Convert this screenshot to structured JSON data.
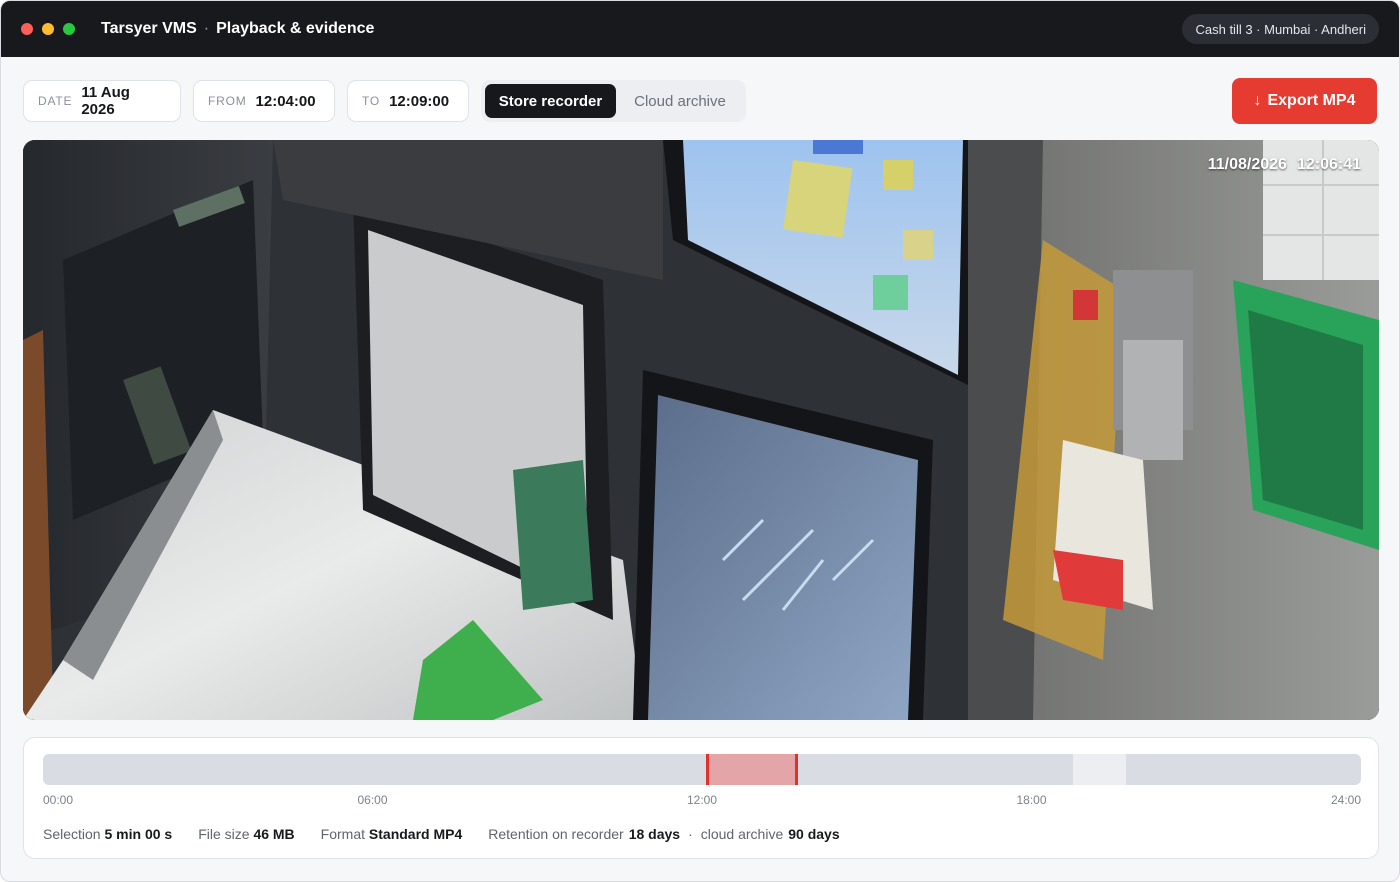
{
  "window": {
    "app_name": "Tarsyer VMS",
    "separator": "·",
    "page_title": "Playback & evidence",
    "location": "Cash till 3 · Mumbai · Andheri"
  },
  "toolbar": {
    "date": {
      "label": "DATE",
      "value": "11 Aug 2026"
    },
    "from": {
      "label": "FROM",
      "value": "12:04:00"
    },
    "to": {
      "label": "TO",
      "value": "12:09:00"
    },
    "source_options": [
      "Store recorder",
      "Cloud archive"
    ],
    "source_selected": "Store recorder",
    "export_icon": "down-arrow-icon",
    "export_glyph": "↓",
    "export_label": "Export MP4",
    "accent_color": "#e53b30"
  },
  "video": {
    "timestamp_date": "11/08/2026",
    "timestamp_time": "12:06:41"
  },
  "timeline": {
    "range_hours": [
      0,
      24
    ],
    "selection_hours": [
      12.067,
      13.75
    ],
    "recording_gap_hours": [
      18.75,
      19.72
    ],
    "ticks": [
      "00:00",
      "06:00",
      "12:00",
      "18:00",
      "24:00"
    ],
    "selection_color": "#e0312a"
  },
  "stats": {
    "selection_label": "Selection",
    "selection_value": "5 min 00 s",
    "filesize_label": "File size",
    "filesize_value": "46 MB",
    "format_label": "Format",
    "format_value": "Standard MP4",
    "retention_label": "Retention on recorder",
    "retention_value": "18 days",
    "cloud_label": "cloud archive",
    "cloud_value": "90 days",
    "dot": "·"
  }
}
